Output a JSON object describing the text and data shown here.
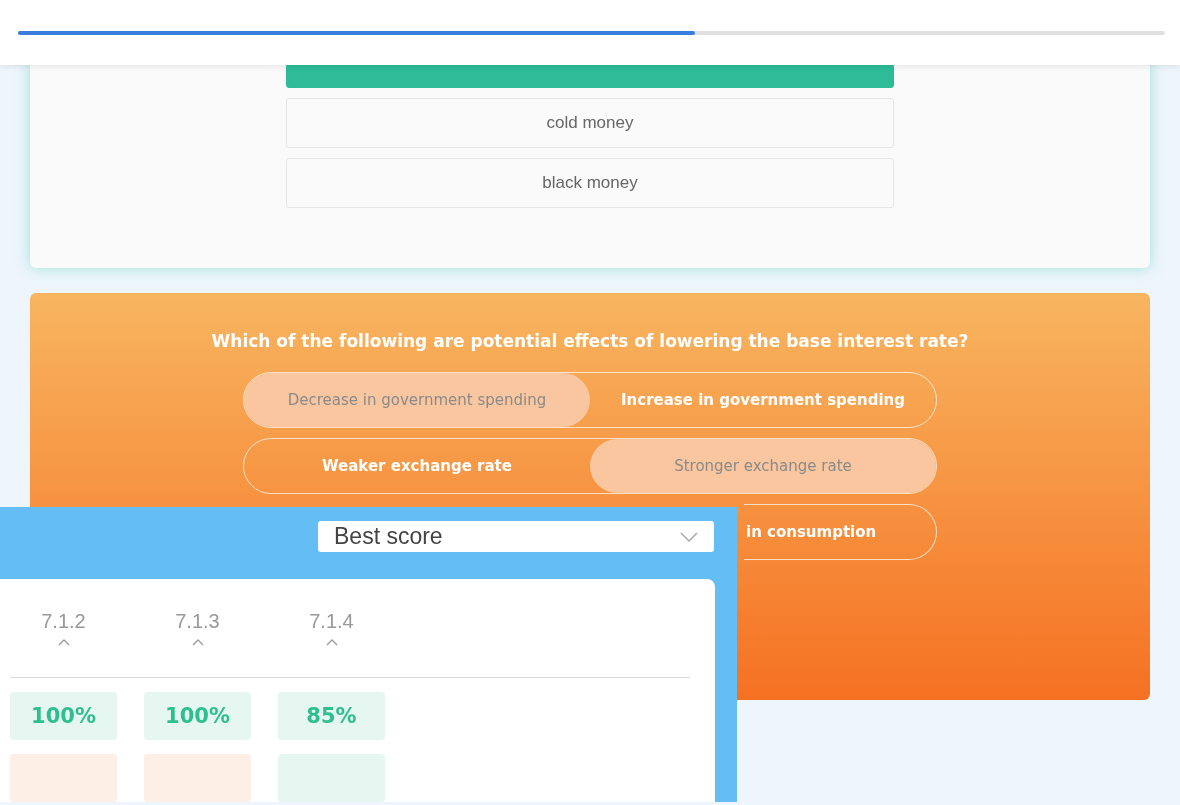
{
  "progress": {
    "level": 0.59
  },
  "question_1": {
    "options": [
      {
        "selected": true
      },
      {
        "label": "cold money",
        "selected": false
      },
      {
        "label": "black money",
        "selected": false
      }
    ]
  },
  "question_2": {
    "prompt": "Which of the following are potential effects of lowering the base interest rate?",
    "pairs": [
      {
        "left": {
          "label": "Decrease in government spending",
          "selected": true
        },
        "right": {
          "label": "Increase in government spending",
          "selected": false
        }
      },
      {
        "left": {
          "label": "Weaker exchange rate",
          "selected": false
        },
        "right": {
          "label": "Stronger exchange rate",
          "selected": true
        }
      },
      {
        "right": {
          "label": "in consumption",
          "selected": false
        }
      }
    ]
  },
  "results_panel": {
    "sort_select": {
      "value": "Best score"
    },
    "columns": [
      "7.1.2",
      "7.1.3",
      "7.1.4"
    ],
    "rows": [
      [
        {
          "score": "100%",
          "color": "#e6f6f1"
        },
        {
          "score": "100%",
          "color": "#e6f6f1"
        },
        {
          "score": "85%",
          "color": "#e6f6f1"
        }
      ],
      [
        {
          "color": "#fdeee6"
        },
        {
          "color": "#fdeee6"
        },
        {
          "color": "#e6f6f1"
        }
      ]
    ]
  }
}
